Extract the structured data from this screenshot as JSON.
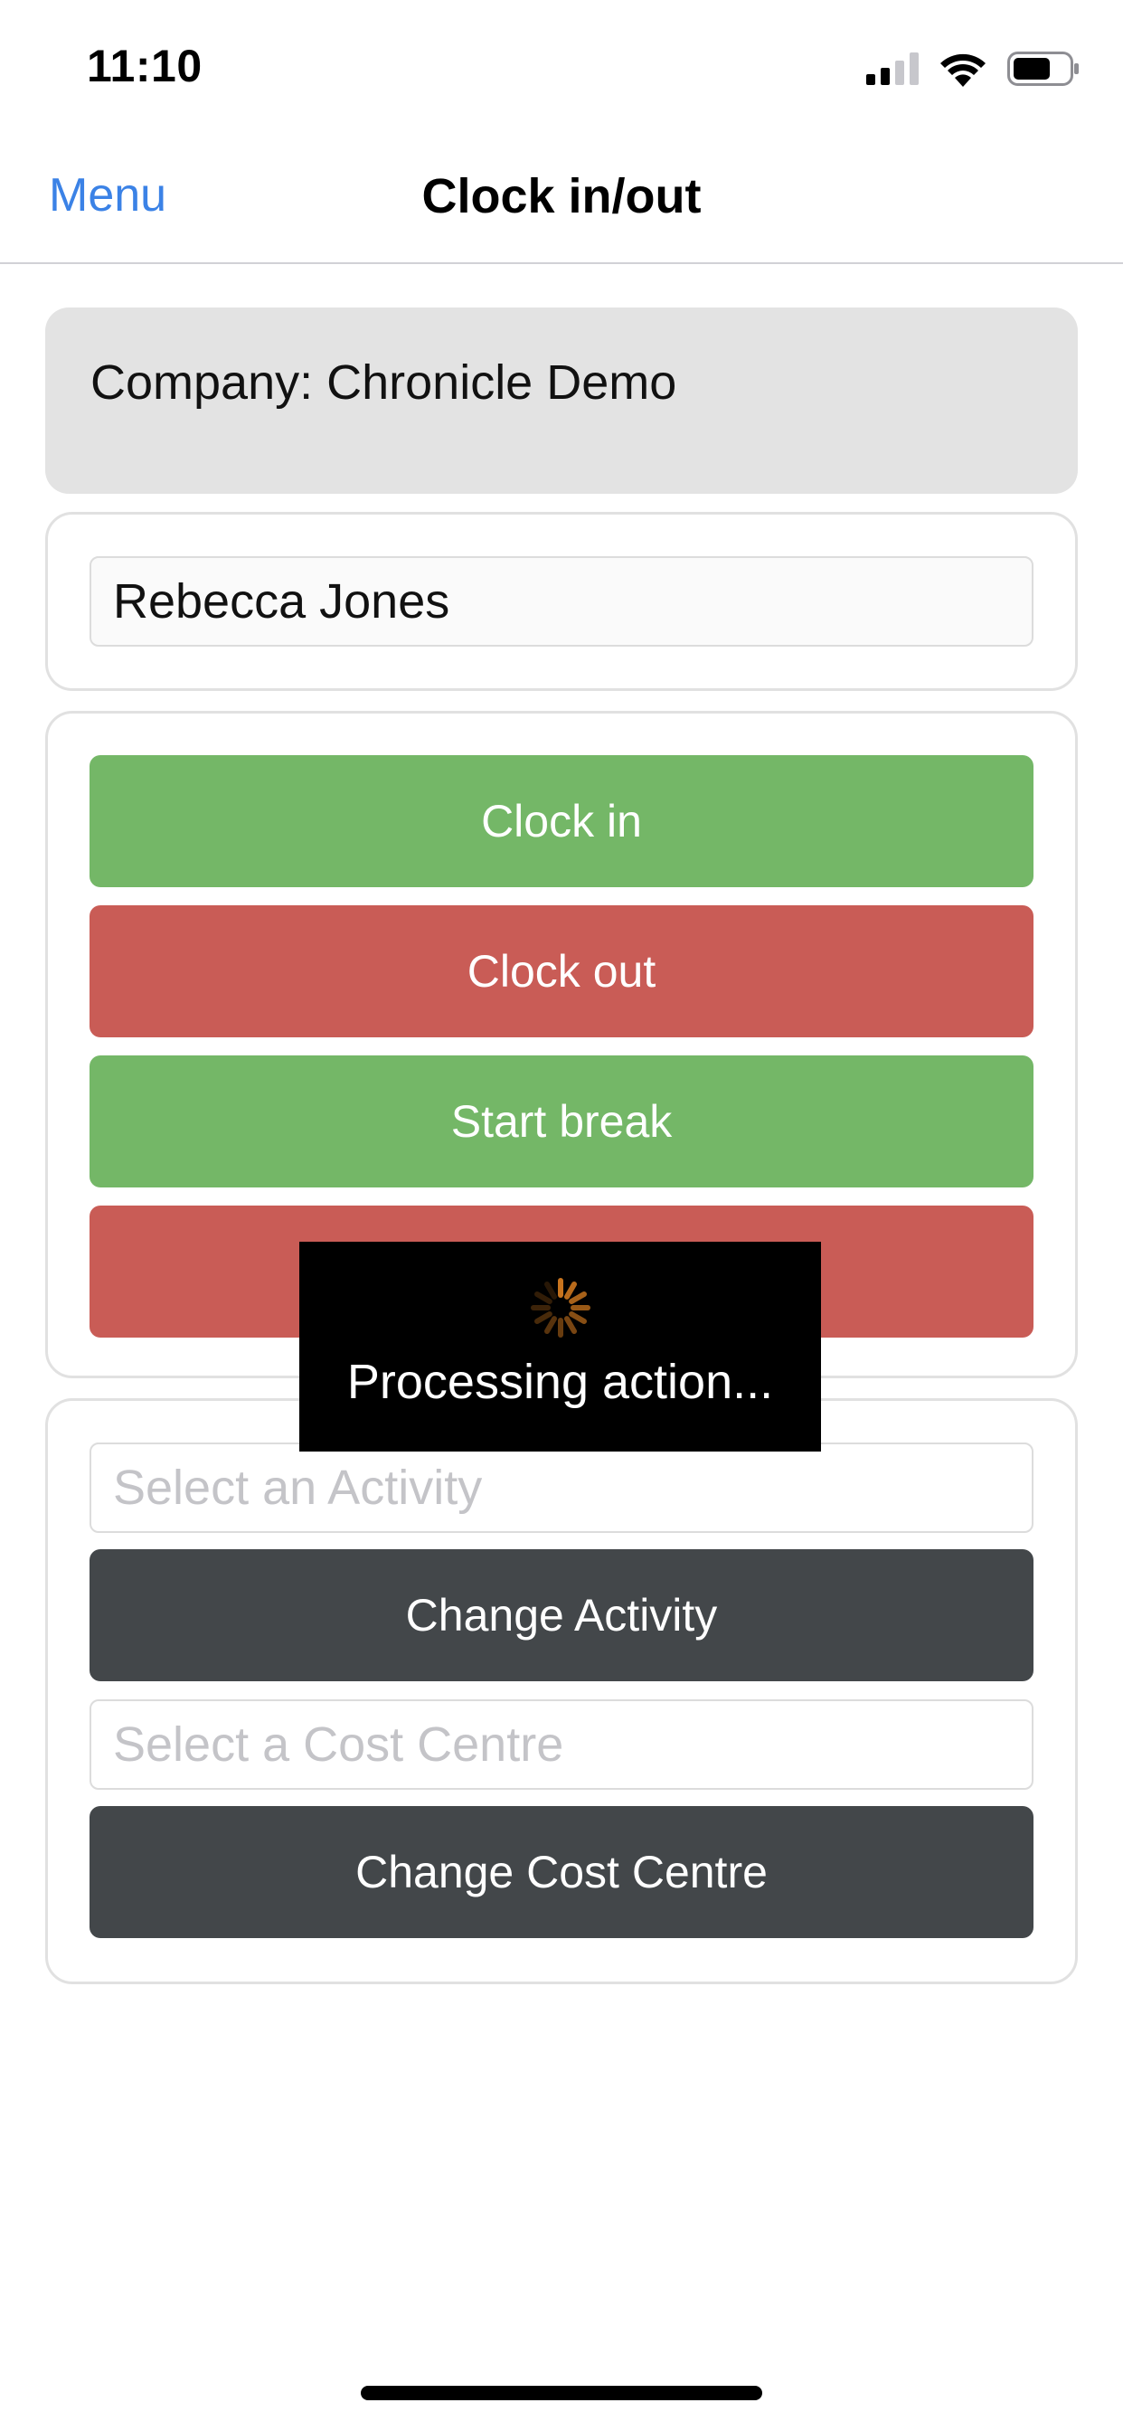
{
  "status_bar": {
    "time": "11:10",
    "icons": [
      "cellular-signal-icon",
      "wifi-icon",
      "battery-icon"
    ]
  },
  "nav": {
    "menu_label": "Menu",
    "title": "Clock in/out"
  },
  "company": {
    "label": "Company: Chronicle Demo"
  },
  "employee": {
    "name": "Rebecca Jones"
  },
  "actions": {
    "clock_in": "Clock in",
    "clock_out": "Clock out",
    "start_break": "Start break",
    "end_break": ""
  },
  "options": {
    "activity_placeholder": "Select an Activity",
    "change_activity": "Change Activity",
    "cost_centre_placeholder": "Select a Cost Centre",
    "change_cost_centre": "Change Cost Centre"
  },
  "overlay": {
    "message": "Processing action..."
  },
  "colors": {
    "accent_blue": "#3b82e6",
    "green": "#74b767",
    "red": "#c95c56",
    "dark": "#43474a",
    "spinner": "#c8741e"
  }
}
